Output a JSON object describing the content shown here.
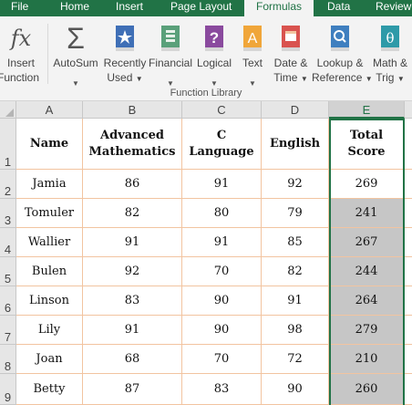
{
  "ribbon": {
    "tabs": [
      "File",
      "Home",
      "Insert",
      "Page Layout",
      "Formulas",
      "Data",
      "Review"
    ],
    "active_tab": "Formulas",
    "buttons": [
      {
        "line1": "Insert",
        "line2": "Function",
        "icon": "fx-icon"
      },
      {
        "line1": "AutoSum",
        "line2": "",
        "icon": "sigma-icon"
      },
      {
        "line1": "Recently",
        "line2": "Used",
        "icon": "star-book-icon"
      },
      {
        "line1": "Financial",
        "line2": "",
        "icon": "money-book-icon"
      },
      {
        "line1": "Logical",
        "line2": "",
        "icon": "question-book-icon"
      },
      {
        "line1": "Text",
        "line2": "",
        "icon": "text-book-icon"
      },
      {
        "line1": "Date &",
        "line2": "Time",
        "icon": "calendar-book-icon"
      },
      {
        "line1": "Lookup &",
        "line2": "Reference",
        "icon": "search-book-icon"
      },
      {
        "line1": "Math &",
        "line2": "Trig",
        "icon": "theta-book-icon"
      }
    ],
    "group_label": "Function Library",
    "colors": {
      "brand": "#217346",
      "ribbon_bg": "#f3f3f3"
    }
  },
  "sheet": {
    "columns": [
      "A",
      "B",
      "C",
      "D",
      "E"
    ],
    "selected_column": "E",
    "rows": [
      "1",
      "2",
      "3",
      "4",
      "5",
      "6",
      "7",
      "8",
      "9"
    ],
    "headers": [
      [
        "Name"
      ],
      [
        "Advanced",
        "Mathematics"
      ],
      [
        "C",
        "Language"
      ],
      [
        "English"
      ],
      [
        "Total",
        "Score"
      ]
    ],
    "data": [
      [
        "Jamia",
        "86",
        "91",
        "92",
        "269"
      ],
      [
        "Tomuler",
        "82",
        "80",
        "79",
        "241"
      ],
      [
        "Wallier",
        "91",
        "91",
        "85",
        "267"
      ],
      [
        "Bulen",
        "92",
        "70",
        "82",
        "244"
      ],
      [
        "Linson",
        "83",
        "90",
        "91",
        "264"
      ],
      [
        "Lily",
        "91",
        "90",
        "98",
        "279"
      ],
      [
        "Joan",
        "68",
        "70",
        "72",
        "210"
      ],
      [
        "Betty",
        "87",
        "83",
        "90",
        "260"
      ]
    ],
    "colors": {
      "grid": "#f2c4a0",
      "selection": "#c6c6c6"
    }
  }
}
